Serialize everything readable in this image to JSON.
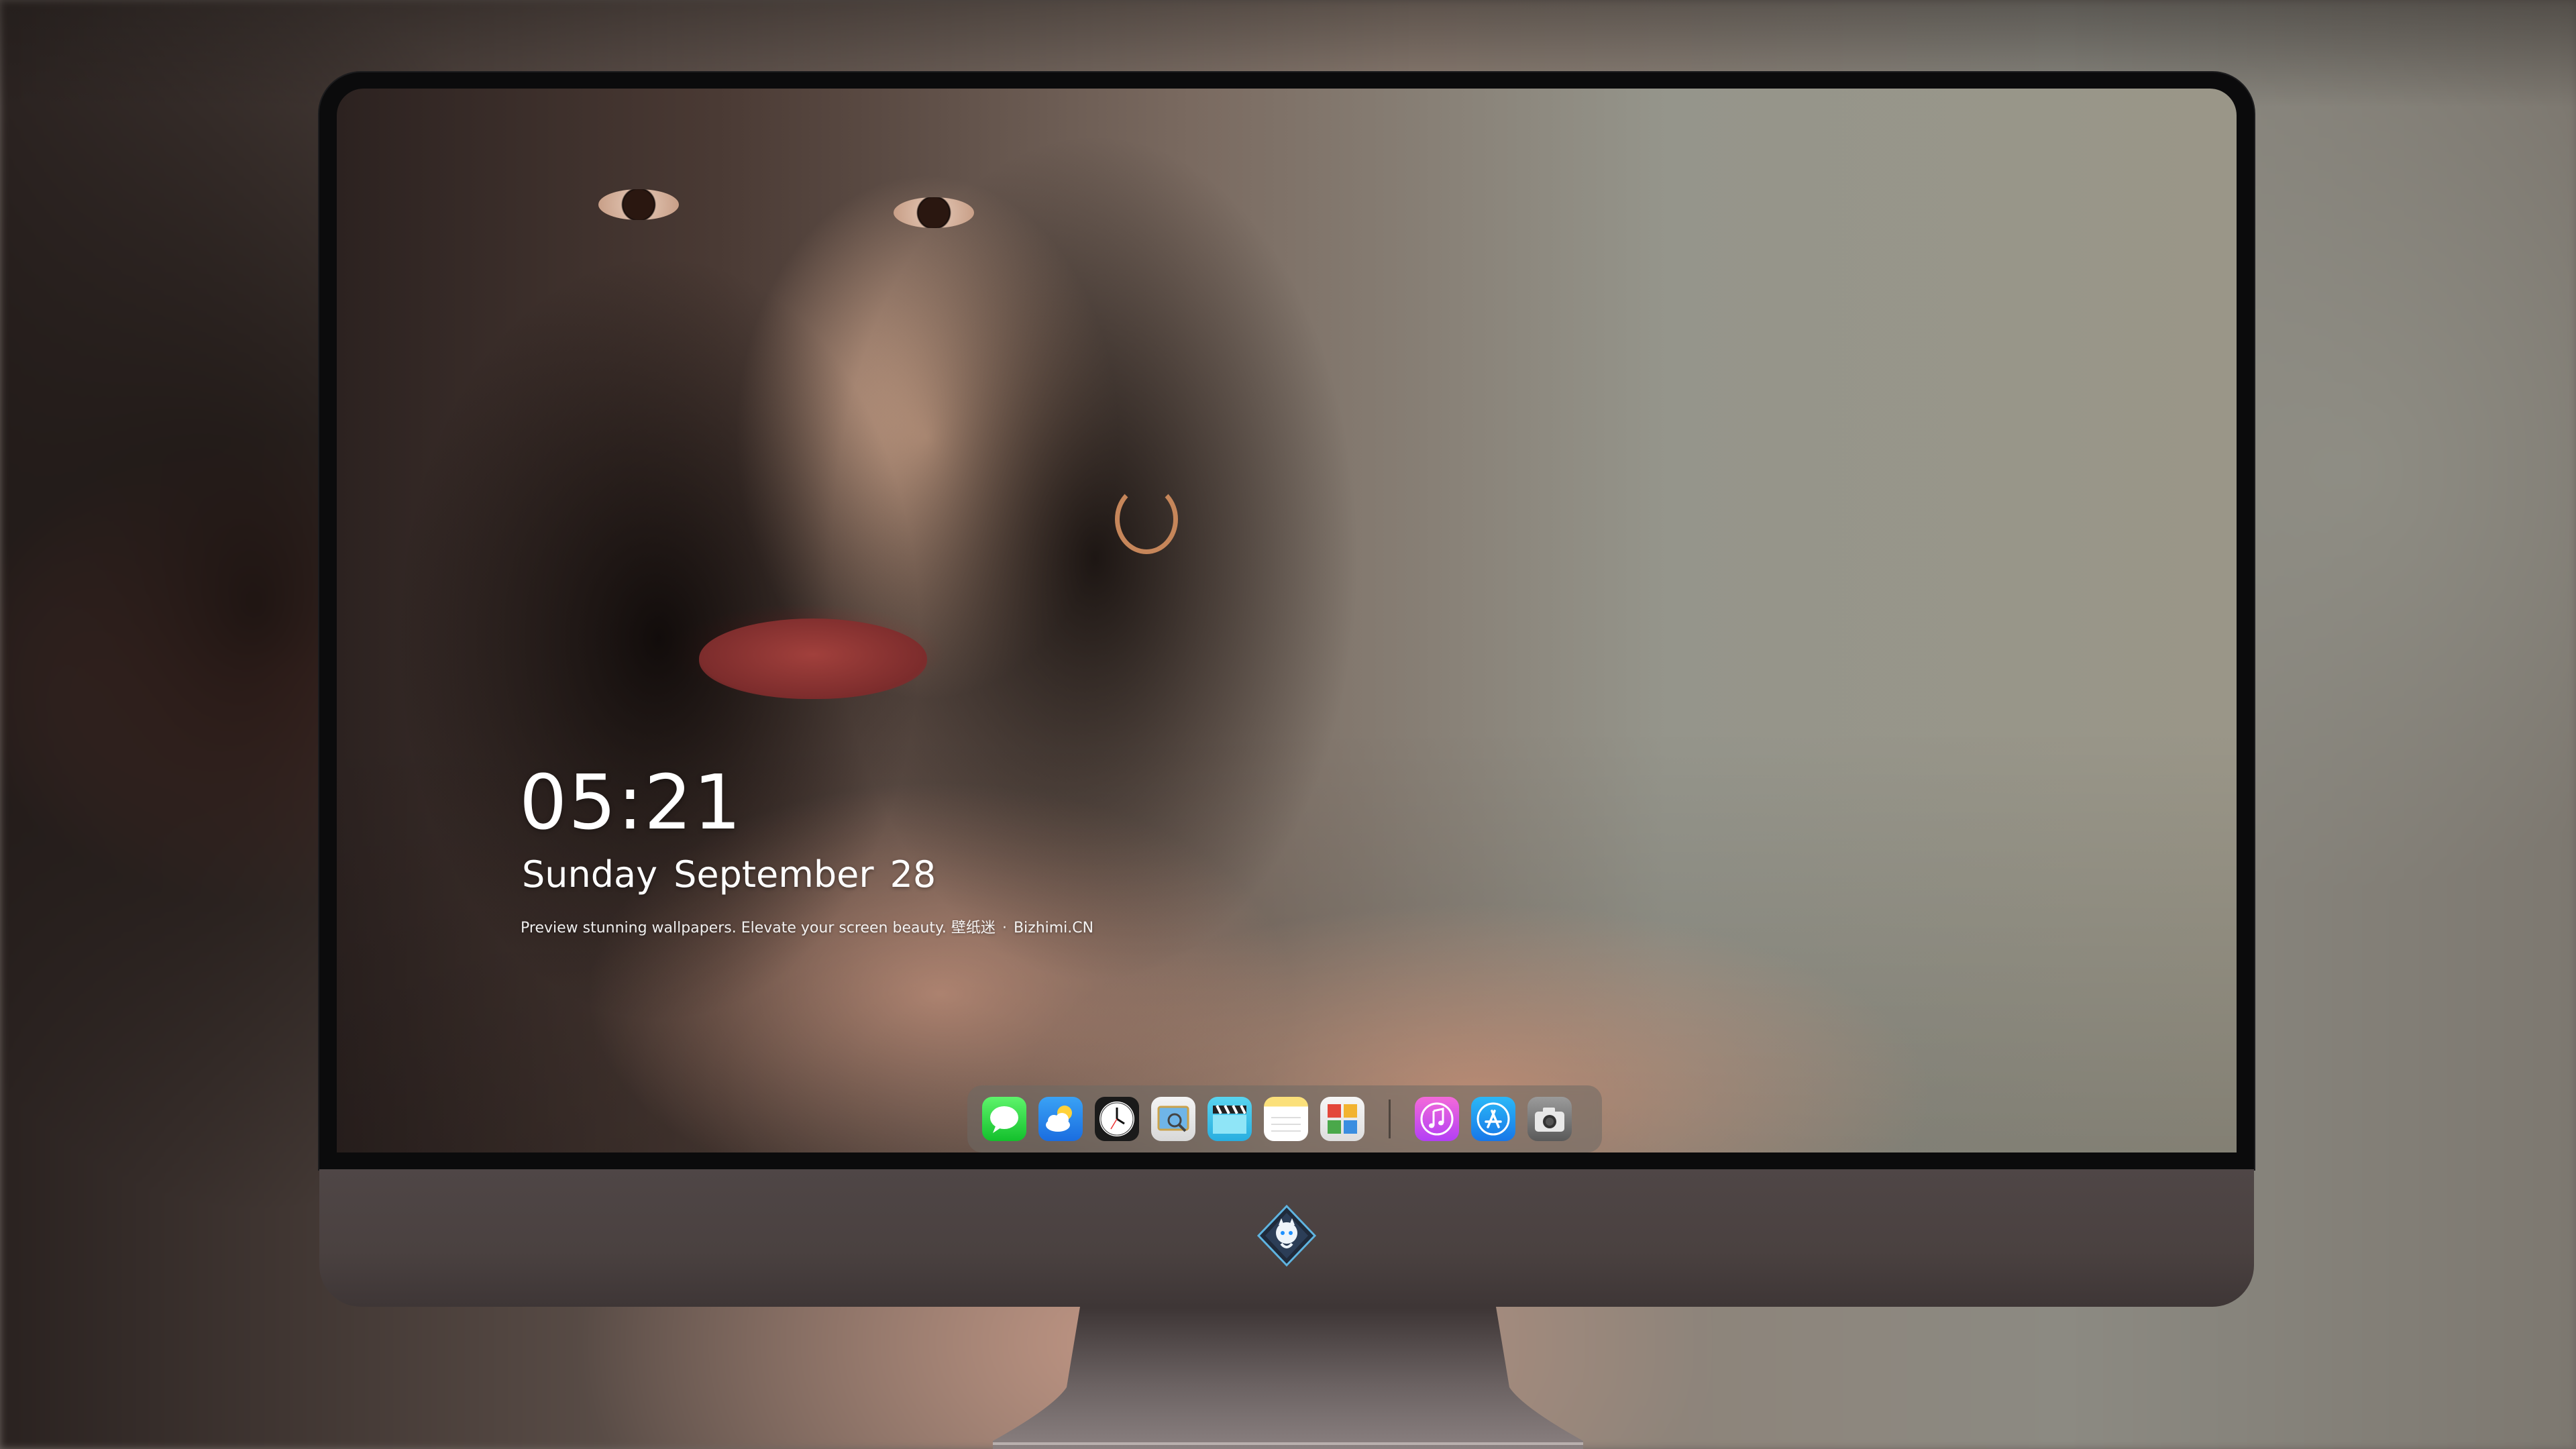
{
  "lockscreen": {
    "time": "05:21",
    "weekday": "Sunday",
    "month": "September",
    "day": "28",
    "tagline": "Preview stunning wallpapers. Elevate your screen beauty.",
    "brand_cn": "壁纸迷",
    "separator": "·",
    "brand": "Bizhimi.CN"
  },
  "dock": {
    "apps": [
      {
        "name": "messages-icon"
      },
      {
        "name": "weather-icon"
      },
      {
        "name": "clock-icon"
      },
      {
        "name": "preview-icon"
      },
      {
        "name": "clips-icon"
      },
      {
        "name": "notes-icon"
      },
      {
        "name": "photo-booth-icon"
      },
      {
        "name": "music-icon"
      },
      {
        "name": "app-store-icon"
      },
      {
        "name": "camera-icon"
      }
    ]
  },
  "colors": {
    "bezel": "#0b0b0c",
    "chin": "#4a4140",
    "text": "#ffffff"
  }
}
